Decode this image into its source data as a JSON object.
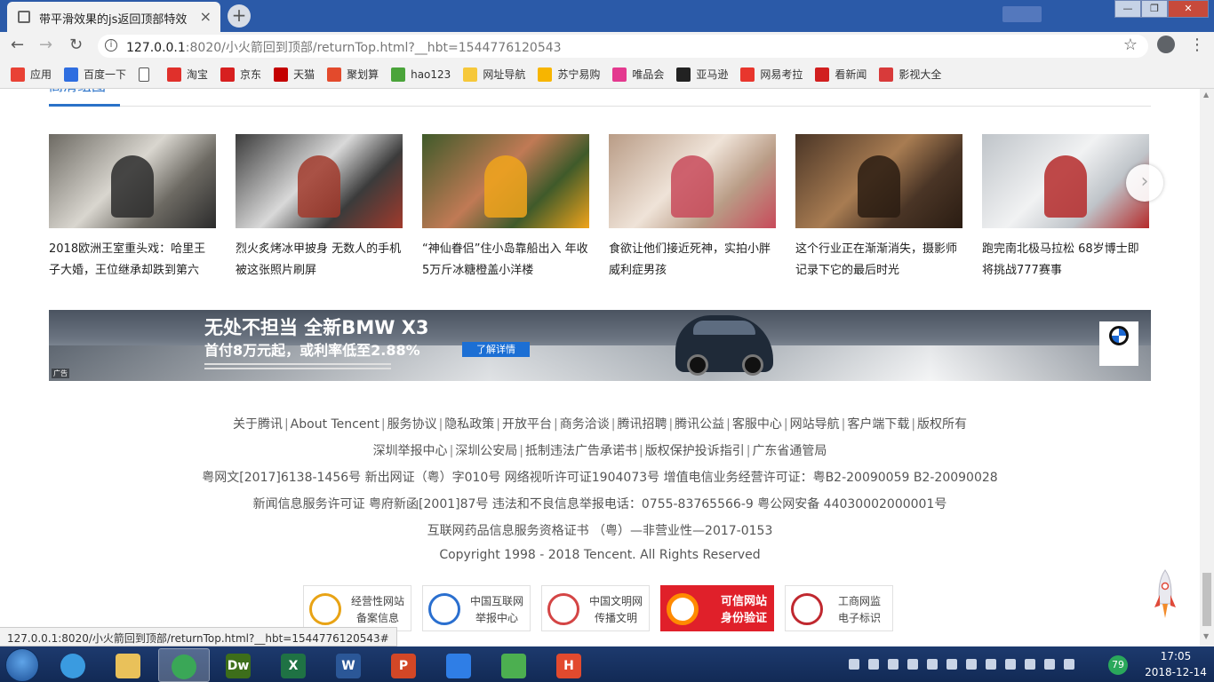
{
  "browser": {
    "tab_title": "带平滑效果的js返回顶部特效",
    "tab_close": "×",
    "new_tab": "+",
    "url_host": "127.0.0.1",
    "url_rest": ":8020/小火箭回到顶部/returnTop.html?__hbt=1544776120543",
    "back": "←",
    "forward": "→",
    "reload": "↻",
    "star": "☆",
    "menu": "⋮",
    "win_min": "—",
    "win_max": "❐",
    "win_close": "✕"
  },
  "bookmarks": [
    {
      "label": "应用",
      "icon": "apps-icon",
      "color": "#e94235"
    },
    {
      "label": "百度一下",
      "icon": "baidu-icon",
      "color": "#2f6ee0"
    },
    {
      "label": "",
      "icon": "page-icon",
      "color": "#ffffff"
    },
    {
      "label": "淘宝",
      "icon": "taobao-icon",
      "color": "#e0302b"
    },
    {
      "label": "京东",
      "icon": "jd-icon",
      "color": "#d71f1f"
    },
    {
      "label": "天猫",
      "icon": "tmall-icon",
      "color": "#c40000"
    },
    {
      "label": "聚划算",
      "icon": "juhuasuan-icon",
      "color": "#e34a2c"
    },
    {
      "label": "hao123",
      "icon": "hao123-icon",
      "color": "#4aa43a"
    },
    {
      "label": "网址导航",
      "icon": "nav-icon",
      "color": "#f6c83a"
    },
    {
      "label": "苏宁易购",
      "icon": "suning-icon",
      "color": "#f7b500"
    },
    {
      "label": "唯品会",
      "icon": "vip-icon",
      "color": "#e4398f"
    },
    {
      "label": "亚马逊",
      "icon": "amazon-icon",
      "color": "#222222"
    },
    {
      "label": "网易考拉",
      "icon": "kaola-icon",
      "color": "#e8362d"
    },
    {
      "label": "看新闻",
      "icon": "news-icon",
      "color": "#d11f1f"
    },
    {
      "label": "影视大全",
      "icon": "video-icon",
      "color": "#d83a3a"
    }
  ],
  "section": {
    "label": "高清组图"
  },
  "gallery": [
    {
      "title": "2018欧洲王室重头戏：哈里王子大婚，王位继承却跌到第六",
      "palette": [
        "#6d6a63",
        "#d9d6cf",
        "#2b2b2b"
      ]
    },
    {
      "title": "烈火炙烤冰甲披身 无数人的手机被这张照片刷屏",
      "palette": [
        "#3b3b3b",
        "#d9d9d9",
        "#a13a2c"
      ]
    },
    {
      "title": "“神仙眷侣”住小岛靠船出入 年收5万斤冰糖橙盖小洋楼",
      "palette": [
        "#3f5a2a",
        "#c07a55",
        "#f0a41b"
      ]
    },
    {
      "title": "食欲让他们接近死神，实拍小胖威利症男孩",
      "palette": [
        "#b99c86",
        "#efe3d8",
        "#c84a5a"
      ]
    },
    {
      "title": "这个行业正在渐渐消失，摄影师记录下它的最后时光",
      "palette": [
        "#4a3526",
        "#a87c52",
        "#2a1c12"
      ]
    },
    {
      "title": "跑完南北极马拉松 68岁博士即将挑战777赛事",
      "palette": [
        "#bfc4c9",
        "#f1f2f3",
        "#b52a2a"
      ]
    }
  ],
  "carousel": {
    "next": "›"
  },
  "ad": {
    "headline": "无处不担当 全新BMW X3",
    "sub": "首付8万元起，或利率低至2.88%",
    "cta": "了解详情",
    "tag": "广告"
  },
  "footer": {
    "links_row1": [
      "关于腾讯",
      "About Tencent",
      "服务协议",
      "隐私政策",
      "开放平台",
      "商务洽谈",
      "腾讯招聘",
      "腾讯公益",
      "客服中心",
      "网站导航",
      "客户端下载",
      "版权所有"
    ],
    "links_row2": [
      "深圳举报中心",
      "深圳公安局",
      "抵制违法广告承诺书",
      "版权保护投诉指引",
      "广东省通管局"
    ],
    "license1": "粤网文[2017]6138-1456号 新出网证（粤）字010号 网络视听许可证1904073号 增值电信业务经营许可证：粤B2-20090059 B2-20090028",
    "license2": "新闻信息服务许可证 粤府新函[2001]87号 违法和不良信息举报电话：0755-83765566-9 粤公网安备 44030002000001号",
    "license3": "互联网药品信息服务资格证书 （粤）—非营业性—2017-0153",
    "copyright": "Copyright 1998 - 2018 Tencent. All Rights Reserved",
    "separator": "|"
  },
  "badges": [
    {
      "line1": "经营性网站",
      "line2": "备案信息",
      "icon": "icp-icon",
      "color": "#e8a315"
    },
    {
      "line1": "中国互联网",
      "line2": "举报中心",
      "icon": "report-icon",
      "color": "#2a6fcf"
    },
    {
      "line1": "中国文明网",
      "line2": "传播文明",
      "icon": "civilization-icon",
      "color": "#d44545"
    },
    {
      "line1": "可信网站",
      "line2": "身份验证",
      "icon": "trusted-site-icon",
      "color": "#ff8a00"
    },
    {
      "line1": "工商网监",
      "line2": "电子标识",
      "icon": "business-supervision-icon",
      "color": "#c0282f"
    }
  ],
  "status_bar": {
    "url": "127.0.0.1:8020/小火箭回到顶部/returnTop.html?__hbt=1544776120543#"
  },
  "taskbar": {
    "apps": [
      {
        "name": "ie-icon",
        "label": "",
        "color": "#3a9be0",
        "active": false
      },
      {
        "name": "explorer-icon",
        "label": "",
        "color": "#e9c15a",
        "active": false
      },
      {
        "name": "chrome-icon",
        "label": "",
        "color": "#3aa757",
        "active": true
      },
      {
        "name": "dreamweaver-icon",
        "label": "Dw",
        "color": "#3d6e1a",
        "active": false
      },
      {
        "name": "excel-icon",
        "label": "X",
        "color": "#1f7244",
        "active": false
      },
      {
        "name": "word-icon",
        "label": "W",
        "color": "#2b5797",
        "active": false
      },
      {
        "name": "powerpoint-icon",
        "label": "P",
        "color": "#d24726",
        "active": false
      },
      {
        "name": "baidu-netdisk-icon",
        "label": "",
        "color": "#2f7ee6",
        "active": false
      },
      {
        "name": "refresh-tool-icon",
        "label": "",
        "color": "#4caf50",
        "active": false
      },
      {
        "name": "hbuilder-icon",
        "label": "H",
        "color": "#e24a2e",
        "active": false
      }
    ],
    "tray_badge": "79",
    "time": "17:05",
    "date": "2018-12-14"
  }
}
